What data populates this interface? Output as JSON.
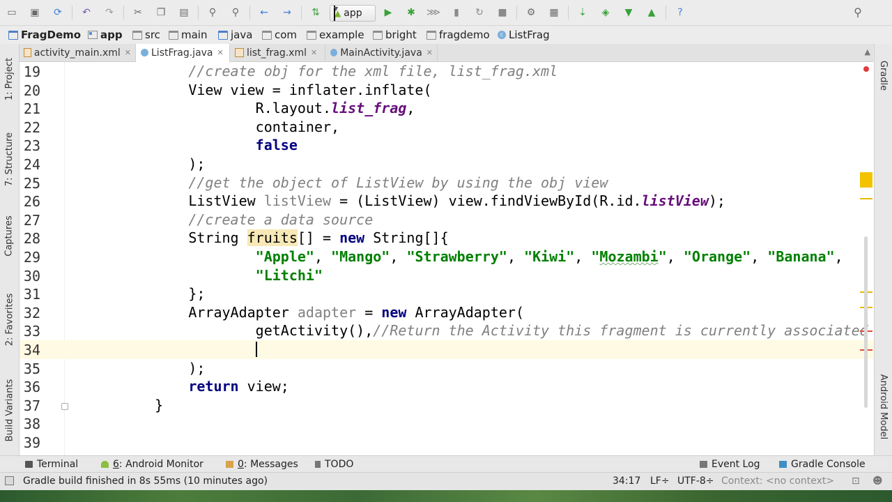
{
  "toolbar": {
    "run_config": "app",
    "icons": [
      "folder-icon",
      "save-icon",
      "sync-icon",
      "undo-icon",
      "redo-icon",
      "cut-icon",
      "copy-icon",
      "paste-icon",
      "find-icon",
      "replace-icon",
      "back-icon",
      "forward-icon",
      "make-icon",
      "run-icon",
      "debug-icon",
      "attach-icon",
      "profile-icon",
      "apply-changes-icon",
      "stop-icon",
      "project-structure-icon",
      "sdk-manager-icon",
      "avd-manager-icon",
      "android-icon",
      "help-icon",
      "search-icon"
    ]
  },
  "breadcrumb": [
    "FragDemo",
    "app",
    "src",
    "main",
    "java",
    "com",
    "example",
    "bright",
    "fragdemo",
    "ListFrag"
  ],
  "tabs": [
    {
      "label": "activity_main.xml",
      "type": "xml",
      "active": false
    },
    {
      "label": "ListFrag.java",
      "type": "java",
      "active": true
    },
    {
      "label": "list_frag.xml",
      "type": "xml",
      "active": false
    },
    {
      "label": "MainActivity.java",
      "type": "java",
      "active": false
    }
  ],
  "left_tools": [
    "1: Project",
    "7: Structure",
    "Captures",
    "2: Favorites",
    "Build Variants"
  ],
  "right_tools": [
    "Gradle",
    "Android Model"
  ],
  "editor": {
    "current_line": 34,
    "lines": [
      {
        "n": "19",
        "parts": [
          [
            "i",
            "        "
          ],
          [
            "comment",
            "//create obj for the xml file, list_frag.xml"
          ]
        ]
      },
      {
        "n": "20",
        "parts": [
          [
            "i",
            "        "
          ],
          [
            "plain",
            "View view = inflater.inflate("
          ]
        ]
      },
      {
        "n": "21",
        "parts": [
          [
            "i",
            "                "
          ],
          [
            "plain",
            "R.layout."
          ],
          [
            "field",
            "list_frag"
          ],
          [
            "plain",
            ","
          ]
        ]
      },
      {
        "n": "22",
        "parts": [
          [
            "i",
            "                "
          ],
          [
            "plain",
            "container,"
          ]
        ]
      },
      {
        "n": "23",
        "parts": [
          [
            "i",
            "                "
          ],
          [
            "kw",
            "false"
          ]
        ]
      },
      {
        "n": "24",
        "parts": [
          [
            "i",
            "        "
          ],
          [
            "plain",
            ");"
          ]
        ]
      },
      {
        "n": "25",
        "parts": [
          [
            "i",
            "        "
          ],
          [
            "comment",
            "//get the object of ListView by using the obj view"
          ]
        ]
      },
      {
        "n": "26",
        "parts": [
          [
            "i",
            "        "
          ],
          [
            "plain",
            "ListView "
          ],
          [
            "unused",
            "listView"
          ],
          [
            "plain",
            " = (ListView) view.findViewById(R.id."
          ],
          [
            "field",
            "listView"
          ],
          [
            "plain",
            ");"
          ]
        ]
      },
      {
        "n": "27",
        "parts": [
          [
            "i",
            "        "
          ],
          [
            "comment",
            "//create a data source"
          ]
        ]
      },
      {
        "n": "28",
        "parts": [
          [
            "i",
            "        "
          ],
          [
            "plain",
            "String "
          ],
          [
            "hl",
            "fruits"
          ],
          [
            "plain",
            "[] = "
          ],
          [
            "kw",
            "new"
          ],
          [
            "plain",
            " String[]{"
          ]
        ]
      },
      {
        "n": "29",
        "parts": [
          [
            "i",
            "                "
          ],
          [
            "str",
            "\"Apple\""
          ],
          [
            "plain",
            ", "
          ],
          [
            "str",
            "\"Mango\""
          ],
          [
            "plain",
            ", "
          ],
          [
            "str",
            "\"Strawberry\""
          ],
          [
            "plain",
            ", "
          ],
          [
            "str",
            "\"Kiwi\""
          ],
          [
            "plain",
            ", "
          ],
          [
            "str",
            "\""
          ],
          [
            "strsq",
            "Mozambi"
          ],
          [
            "str",
            "\""
          ],
          [
            "plain",
            ", "
          ],
          [
            "str",
            "\"Orange\""
          ],
          [
            "plain",
            ", "
          ],
          [
            "str",
            "\"Banana\""
          ],
          [
            "plain",
            ","
          ]
        ]
      },
      {
        "n": "30",
        "parts": [
          [
            "i",
            "                "
          ],
          [
            "str",
            "\"Litchi\""
          ]
        ]
      },
      {
        "n": "31",
        "parts": [
          [
            "i",
            "        "
          ],
          [
            "plain",
            "};"
          ]
        ]
      },
      {
        "n": "32",
        "parts": [
          [
            "i",
            "        "
          ],
          [
            "plain",
            "ArrayAdapter "
          ],
          [
            "unused",
            "adapter"
          ],
          [
            "plain",
            " = "
          ],
          [
            "kw",
            "new"
          ],
          [
            "plain",
            " ArrayAdapter("
          ]
        ]
      },
      {
        "n": "33",
        "parts": [
          [
            "i",
            "                "
          ],
          [
            "plain",
            "getActivity(),"
          ],
          [
            "comment",
            "//Return the Activity this fragment is currently associated"
          ]
        ]
      },
      {
        "n": "34",
        "parts": [
          [
            "i",
            "                "
          ]
        ]
      },
      {
        "n": "35",
        "parts": [
          [
            "i",
            "        "
          ],
          [
            "plain",
            ");"
          ]
        ]
      },
      {
        "n": "36",
        "parts": [
          [
            "i",
            "        "
          ],
          [
            "kw",
            "return"
          ],
          [
            "plain",
            " view;"
          ]
        ]
      },
      {
        "n": "37",
        "parts": [
          [
            "i",
            "    "
          ],
          [
            "plain",
            "}"
          ]
        ]
      },
      {
        "n": "38",
        "parts": []
      },
      {
        "n": "39",
        "parts": []
      }
    ]
  },
  "bottom_tools": {
    "terminal": "Terminal",
    "android_monitor_num": "6",
    "android_monitor": ": Android Monitor",
    "messages_num": "0",
    "messages": ": Messages",
    "todo": "TODO",
    "event_log": "Event Log",
    "gradle_console": "Gradle Console"
  },
  "status": {
    "message": "Gradle build finished in 8s 55ms (10 minutes ago)",
    "position": "34:17",
    "line_sep": "LF÷",
    "encoding": "UTF-8÷",
    "context": "Context: <no context>"
  },
  "colors": {
    "comment": "#808080",
    "keyword": "#000080",
    "string": "#008000",
    "field": "#660e7a",
    "current_line": "#fffae3"
  }
}
